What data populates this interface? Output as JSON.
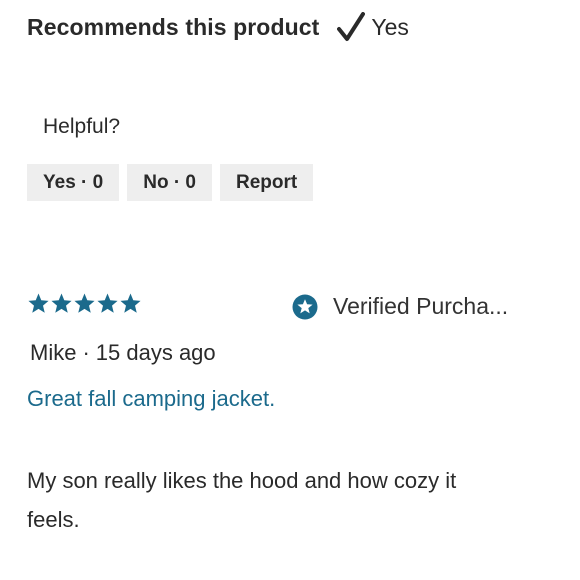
{
  "recommendation": {
    "label": "Recommends this product",
    "value": "Yes",
    "icon": "checkmark-icon"
  },
  "helpful": {
    "label": "Helpful?",
    "buttons": [
      {
        "label": "Yes · 0"
      },
      {
        "label": "No · 0"
      },
      {
        "label": "Report"
      }
    ]
  },
  "review": {
    "rating": 5,
    "rating_max": 5,
    "star_color": "#1b6a8c",
    "verified_label": "Verified Purcha...",
    "verified_icon": "verified-star-badge-icon",
    "author": "Mike",
    "separator": "·",
    "date": "15 days ago",
    "title": "Great fall camping jacket.",
    "title_color": "#1b6a8c",
    "body": "My son really likes the hood and how cozy it feels."
  }
}
